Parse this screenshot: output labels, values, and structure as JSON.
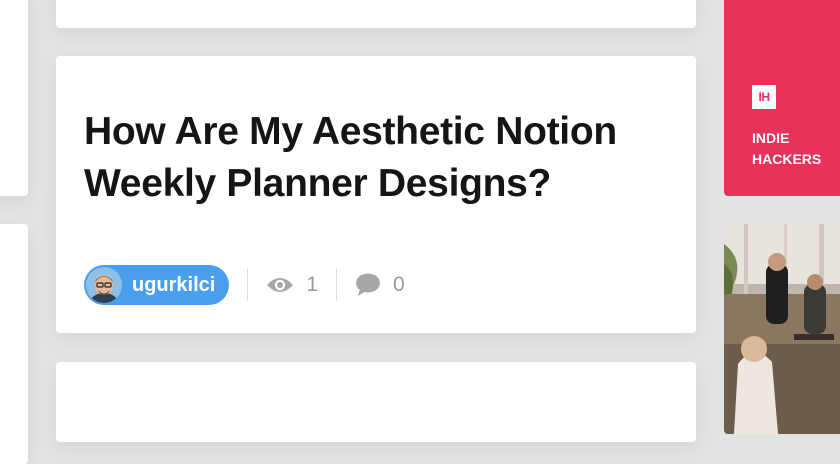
{
  "post": {
    "title": "How Are My Aesthetic Notion Weekly Planner Designs?",
    "author": "ugurkilci",
    "views": "1",
    "comments": "0"
  },
  "sidebar_ad": {
    "logo_text": "IH",
    "name_line1": "INDIE",
    "name_line2": "HACKERS"
  },
  "icons": {
    "views": "eye-icon",
    "comments": "speech-bubble-icon"
  },
  "colors": {
    "author_pill": "#4a9fed",
    "ad_background": "#e8325a",
    "stat_text": "#999999"
  }
}
